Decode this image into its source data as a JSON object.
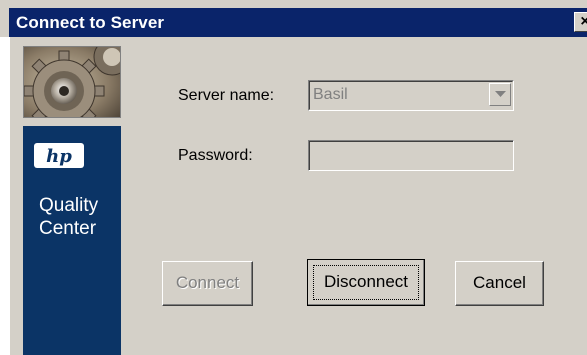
{
  "window": {
    "title": "Connect to Server",
    "close_glyph": "×"
  },
  "branding": {
    "image_icon": "gear-image",
    "logo_text": "hp",
    "product_line1": "Quality",
    "product_line2": "Center"
  },
  "form": {
    "server_label": "Server name:",
    "server_value": "Basil",
    "password_label": "Password:",
    "password_value": ""
  },
  "buttons": {
    "connect_label": "Connect",
    "disconnect_label": "Disconnect",
    "cancel_label": "Cancel"
  },
  "colors": {
    "titlebar": "#0a246a",
    "brand_panel": "#0b3466",
    "dialog_face": "#d4d0c8"
  }
}
